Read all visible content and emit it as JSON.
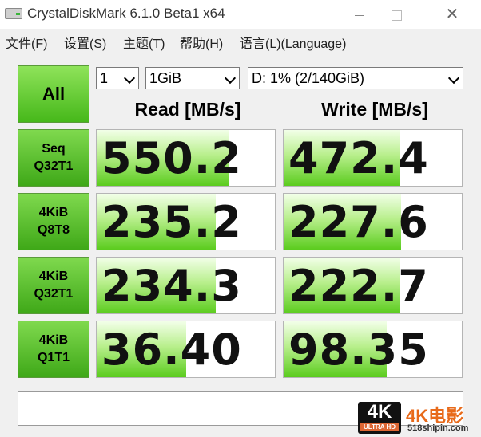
{
  "window": {
    "title": "CrystalDiskMark 6.1.0 Beta1 x64"
  },
  "menu": [
    "文件(F)",
    "设置(S)",
    "主题(T)",
    "帮助(H)",
    "语言(L)(Language)"
  ],
  "controls": {
    "all_label": "All",
    "count_value": "1",
    "size_value": "1GiB",
    "drive_value": "D: 1% (2/140GiB)"
  },
  "headers": {
    "read": "Read [MB/s]",
    "write": "Write [MB/s]"
  },
  "rows": [
    {
      "line1": "Seq",
      "line2": "Q32T1",
      "read": "550.2",
      "write": "472.4",
      "read_level": 0.74,
      "write_level": 0.65
    },
    {
      "line1": "4KiB",
      "line2": "Q8T8",
      "read": "235.2",
      "write": "227.6",
      "read_level": 0.67,
      "write_level": 0.66
    },
    {
      "line1": "4KiB",
      "line2": "Q32T1",
      "read": "234.3",
      "write": "222.7",
      "read_level": 0.67,
      "write_level": 0.65
    },
    {
      "line1": "4KiB",
      "line2": "Q1T1",
      "read": "36.40",
      "write": "98.35",
      "read_level": 0.5,
      "write_level": 0.58
    }
  ],
  "watermark": {
    "badge": "4K",
    "badge_sub": "ULTRA HD",
    "name": "4K电影",
    "url": "518shipin.com"
  }
}
